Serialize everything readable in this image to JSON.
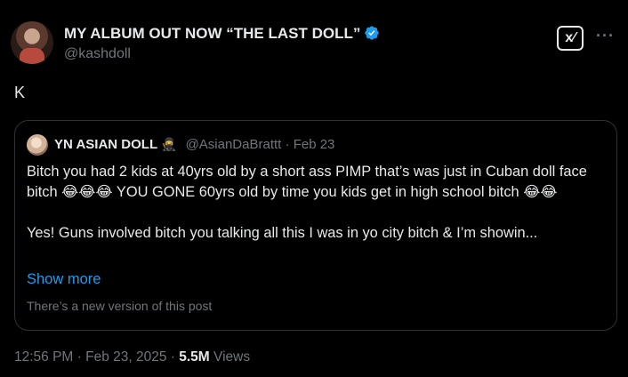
{
  "post": {
    "author": {
      "display_name": "MY ALBUM OUT NOW “THE LAST DOLL”",
      "handle": "@kashdoll",
      "verified": true
    },
    "text": "K",
    "timestamp": "12:56 PM · Feb 23, 2025",
    "separator": " · ",
    "views_count": "5.5M",
    "views_label": "Views"
  },
  "quote": {
    "author": {
      "display_name": "YN ASIAN DOLL",
      "emoji": "🥷",
      "handle": "@AsianDaBrattt",
      "date": "Feb 23",
      "meta_separator": " · "
    },
    "paragraph_1": "Bitch you had 2 kids at 40yrs old by a short ass PIMP that’s was just in Cuban doll face bitch 😂😂😂 YOU GONE 60yrs old by time you kids get in high school bitch 😂😂",
    "paragraph_2": "Yes! Guns involved bitch you talking all this I was in yo city bitch & I’m showin...",
    "show_more": "Show more",
    "new_version_notice": "There’s a new version of this post"
  },
  "actions": {
    "grok_icon_label": "x⁄",
    "more_label": "···"
  },
  "colors": {
    "background": "#000000",
    "text_primary": "#e7e9ea",
    "text_secondary": "#71767b",
    "link": "#1d9bf0",
    "border": "#2f3336",
    "verified_badge": "#1d9bf0"
  },
  "icons": {
    "verified": "verified-badge-icon",
    "grok": "grok-icon",
    "more": "more-options-icon"
  }
}
